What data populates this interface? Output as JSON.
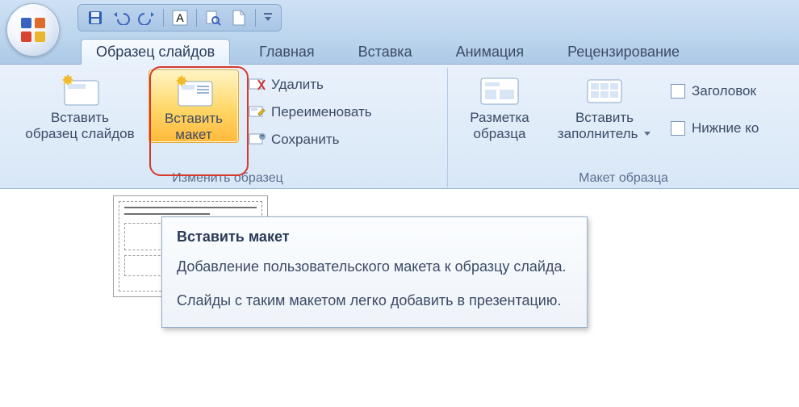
{
  "tabs": {
    "active": "Образец слайдов",
    "others": [
      "Главная",
      "Вставка",
      "Анимация",
      "Рецензирование"
    ]
  },
  "ribbon": {
    "group1_label": "Изменить образец",
    "group2_label": "Макет образца",
    "insert_master_line1": "Вставить",
    "insert_master_line2": "образец слайдов",
    "insert_layout_line1": "Вставить",
    "insert_layout_line2": "макет",
    "delete_label": "Удалить",
    "rename_label": "Переименовать",
    "preserve_label": "Сохранить",
    "master_layout_line1": "Разметка",
    "master_layout_line2": "образца",
    "insert_placeholder_line1": "Вставить",
    "insert_placeholder_line2": "заполнитель",
    "cb_title": "Заголовок",
    "cb_footers": "Нижние ко"
  },
  "tooltip": {
    "title": "Вставить макет",
    "body1": "Добавление пользовательского макета к образцу слайда.",
    "body2": "Слайды с таким макетом легко добавить в презентацию."
  }
}
